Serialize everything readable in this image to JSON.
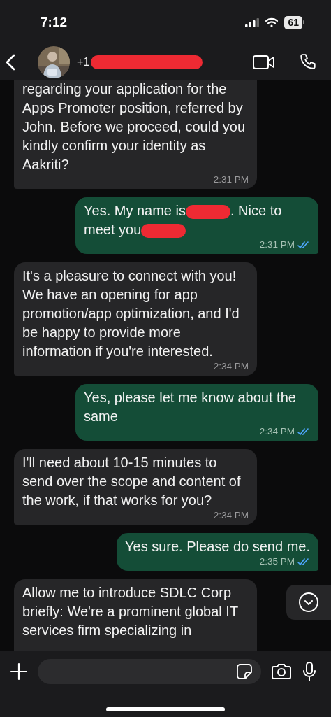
{
  "status_bar": {
    "time": "7:12",
    "battery": "61"
  },
  "header": {
    "contact": [
      {
        "kind": "text",
        "text": "+1"
      },
      {
        "kind": "redacted"
      }
    ]
  },
  "messages": [
    {
      "kind": "incoming",
      "segments": [
        {
          "kind": "text",
          "text": "regarding your application for the Apps Promoter position, referred by John. Before we proceed, could you kindly confirm your identity as Aakriti?"
        }
      ],
      "time": "2:31 PM"
    },
    {
      "kind": "outgoing",
      "segments": [
        {
          "kind": "text",
          "text": "Yes. My name is"
        },
        {
          "kind": "redacted"
        },
        {
          "kind": "text",
          "text": ". Nice to"
        },
        {
          "kind": "text",
          "text": "meet you"
        },
        {
          "kind": "redacted"
        }
      ],
      "time": "2:31 PM",
      "read": true
    },
    {
      "kind": "incoming",
      "segments": [
        {
          "kind": "text",
          "text": "It's a pleasure to connect with you! We have an opening for app promotion/app optimization, and I'd be happy to provide more information if you're interested."
        }
      ],
      "time": "2:34 PM"
    },
    {
      "kind": "outgoing",
      "segments": [
        {
          "kind": "text",
          "text": "Yes, please let me know about the same"
        }
      ],
      "time": "2:34 PM",
      "read": true
    },
    {
      "kind": "incoming",
      "segments": [
        {
          "kind": "text",
          "text": "I'll need about 10-15 minutes to send over the scope and content of the work, if that works for you?"
        }
      ],
      "time": "2:34 PM"
    },
    {
      "kind": "outgoing",
      "segments": [
        {
          "kind": "text",
          "text": "Yes sure. Please do send me."
        }
      ],
      "time": "2:35 PM",
      "read": true
    },
    {
      "kind": "incoming",
      "segments": [
        {
          "kind": "text",
          "text": "Allow me to introduce SDLC Corp briefly: We're a prominent global IT services firm specializing in"
        }
      ]
    }
  ]
}
